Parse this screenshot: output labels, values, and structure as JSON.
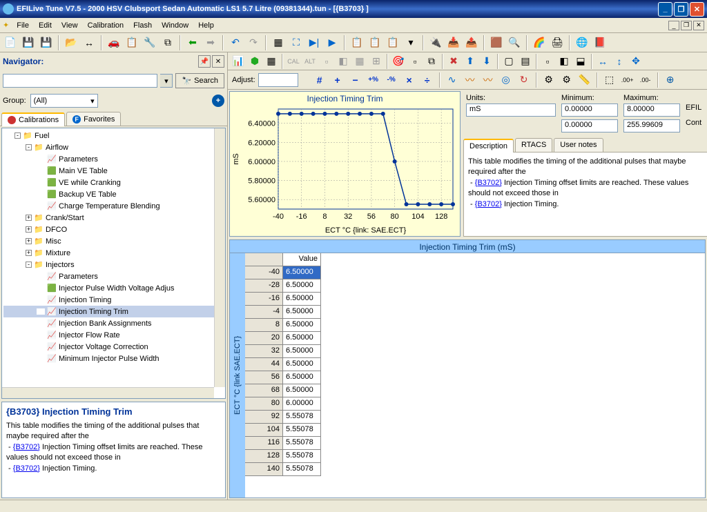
{
  "app": {
    "title": "EFILive Tune V7.5 - 2000 HSV Clubsport Sedan Automatic LS1 5.7 Litre (09381344).tun - [{B3703} ]"
  },
  "menu": {
    "items": [
      "File",
      "Edit",
      "View",
      "Calibration",
      "Flash",
      "Window",
      "Help"
    ]
  },
  "navigator": {
    "title": "Navigator:",
    "search_btn": "Search",
    "group_label": "Group:",
    "group_value": "(All)",
    "tabs": {
      "calibrations": "Calibrations",
      "favorites": "Favorites"
    }
  },
  "tree": {
    "root": "Fuel",
    "nodes": [
      {
        "indent": 1,
        "exp": "-",
        "icon": "folder",
        "label": "Fuel"
      },
      {
        "indent": 2,
        "exp": "-",
        "icon": "folder",
        "label": "Airflow"
      },
      {
        "indent": 3,
        "exp": "",
        "icon": "table",
        "label": "Parameters"
      },
      {
        "indent": 3,
        "exp": "",
        "icon": "cube",
        "label": "Main VE Table"
      },
      {
        "indent": 3,
        "exp": "",
        "icon": "cube",
        "label": "VE while Cranking"
      },
      {
        "indent": 3,
        "exp": "",
        "icon": "cube",
        "label": "Backup VE Table"
      },
      {
        "indent": 3,
        "exp": "",
        "icon": "table",
        "label": "Charge Temperature Blending"
      },
      {
        "indent": 2,
        "exp": "+",
        "icon": "folder",
        "label": "Crank/Start"
      },
      {
        "indent": 2,
        "exp": "+",
        "icon": "folder",
        "label": "DFCO"
      },
      {
        "indent": 2,
        "exp": "+",
        "icon": "folder",
        "label": "Misc"
      },
      {
        "indent": 2,
        "exp": "+",
        "icon": "folder",
        "label": "Mixture"
      },
      {
        "indent": 2,
        "exp": "-",
        "icon": "folder",
        "label": "Injectors"
      },
      {
        "indent": 3,
        "exp": "",
        "icon": "table",
        "label": "Parameters"
      },
      {
        "indent": 3,
        "exp": "",
        "icon": "cube",
        "label": "Injector Pulse Width Voltage Adjus"
      },
      {
        "indent": 3,
        "exp": "",
        "icon": "table",
        "label": "Injection Timing"
      },
      {
        "indent": 3,
        "exp": "",
        "icon": "table",
        "label": "Injection Timing Trim",
        "selected": true
      },
      {
        "indent": 3,
        "exp": "",
        "icon": "table",
        "label": "Injection Bank Assignments"
      },
      {
        "indent": 3,
        "exp": "",
        "icon": "table",
        "label": "Injector Flow Rate"
      },
      {
        "indent": 3,
        "exp": "",
        "icon": "table",
        "label": "Injector Voltage Correction"
      },
      {
        "indent": 3,
        "exp": "",
        "icon": "table",
        "label": "Minimum Injector Pulse Width"
      }
    ]
  },
  "desc": {
    "title": "{B3703} Injection Timing Trim",
    "line1": "This table modifies the timing of the additional pulses that maybe required after the",
    "line2_link": "{B3702}",
    "line2_rest": " Injection Timing offset limits are reached. These values should not exceed those in",
    "line3_link": "{B3702}",
    "line3_rest": " Injection Timing."
  },
  "chart_data": {
    "type": "line",
    "title": "Injection Timing Trim",
    "xlabel": "ECT °C {link: SAE.ECT}",
    "ylabel": "mS",
    "x_ticks": [
      -40,
      -16,
      8,
      32,
      56,
      80,
      104,
      128
    ],
    "y_ticks": [
      5.6,
      5.8,
      6.0,
      6.2,
      6.4
    ],
    "xlim": [
      -40,
      140
    ],
    "ylim": [
      5.5,
      6.55
    ],
    "series": [
      {
        "name": "Injection Timing Trim",
        "x": [
          -40,
          -28,
          -16,
          -4,
          8,
          20,
          32,
          44,
          56,
          68,
          80,
          92,
          104,
          116,
          128,
          140
        ],
        "y": [
          6.5,
          6.5,
          6.5,
          6.5,
          6.5,
          6.5,
          6.5,
          6.5,
          6.5,
          6.5,
          6.0,
          5.55078,
          5.55078,
          5.55078,
          5.55078,
          5.55078
        ]
      }
    ]
  },
  "info": {
    "units_label": "Units:",
    "units_value": "mS",
    "min_label": "Minimum:",
    "min_value": "0.00000",
    "max_label": "Maximum:",
    "max_value": "8.00000",
    "extra1": "EFIL",
    "row2_min": "0.00000",
    "row2_max": "255.99609",
    "row2_extra": "Cont",
    "tabs": {
      "description": "Description",
      "rtacs": "RTACS",
      "usernotes": "User notes"
    },
    "desc_line1": "This table modifies the timing of the additional pulses that maybe required after the",
    "desc_link1": "{B3702}",
    "desc_rest1": " Injection Timing offset limits are reached. These values should not exceed those in",
    "desc_link2": "{B3702}",
    "desc_rest2": " Injection Timing."
  },
  "adjust_label": "Adjust:",
  "table": {
    "title": "Injection Timing Trim (mS)",
    "axis_label": "ECT °C {link SAE.ECT}",
    "col_header": "Value",
    "rows": [
      {
        "k": "-40",
        "v": "6.50000",
        "sel": true
      },
      {
        "k": "-28",
        "v": "6.50000"
      },
      {
        "k": "-16",
        "v": "6.50000"
      },
      {
        "k": "-4",
        "v": "6.50000"
      },
      {
        "k": "8",
        "v": "6.50000"
      },
      {
        "k": "20",
        "v": "6.50000"
      },
      {
        "k": "32",
        "v": "6.50000"
      },
      {
        "k": "44",
        "v": "6.50000"
      },
      {
        "k": "56",
        "v": "6.50000"
      },
      {
        "k": "68",
        "v": "6.50000"
      },
      {
        "k": "80",
        "v": "6.00000"
      },
      {
        "k": "92",
        "v": "5.55078"
      },
      {
        "k": "104",
        "v": "5.55078"
      },
      {
        "k": "116",
        "v": "5.55078"
      },
      {
        "k": "128",
        "v": "5.55078"
      },
      {
        "k": "140",
        "v": "5.55078"
      }
    ]
  }
}
